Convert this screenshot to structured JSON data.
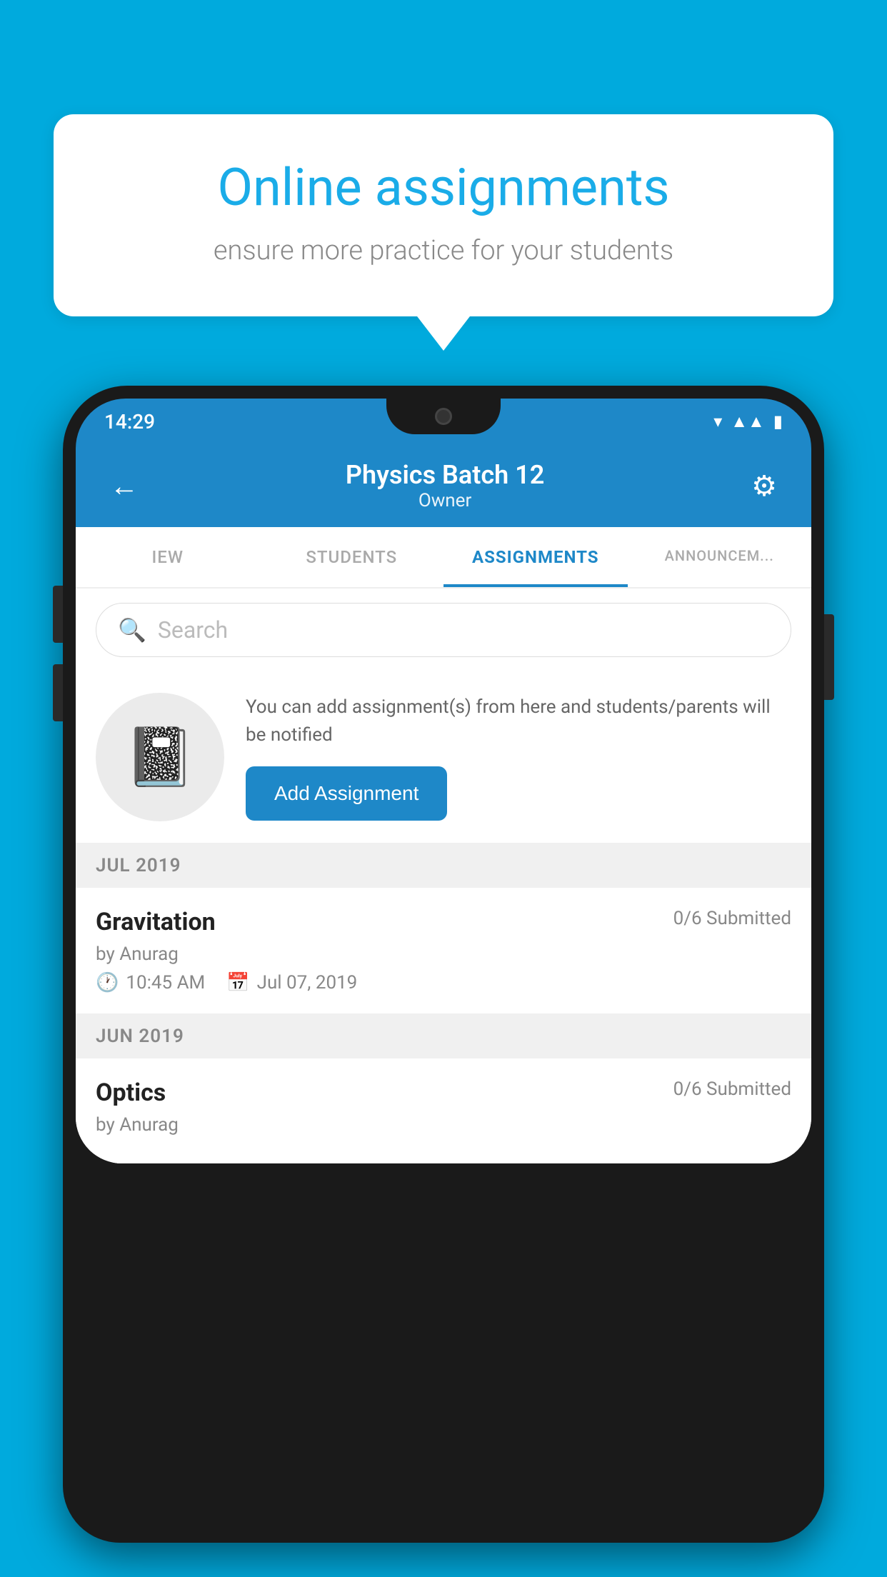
{
  "background_color": "#00AADD",
  "speech_bubble": {
    "title": "Online assignments",
    "subtitle": "ensure more practice for your students"
  },
  "status_bar": {
    "time": "14:29",
    "icons": [
      "wifi",
      "signal",
      "battery"
    ]
  },
  "app_bar": {
    "title": "Physics Batch 12",
    "subtitle": "Owner",
    "back_label": "←",
    "settings_label": "⚙"
  },
  "tabs": [
    {
      "label": "IEW",
      "active": false
    },
    {
      "label": "STUDENTS",
      "active": false
    },
    {
      "label": "ASSIGNMENTS",
      "active": true
    },
    {
      "label": "ANNOUNCEM...",
      "active": false
    }
  ],
  "search": {
    "placeholder": "Search"
  },
  "promo": {
    "description": "You can add assignment(s) from here and students/parents will be notified",
    "button_label": "Add Assignment"
  },
  "months": [
    {
      "label": "JUL 2019",
      "assignments": [
        {
          "title": "Gravitation",
          "submitted": "0/6 Submitted",
          "author": "by Anurag",
          "time": "10:45 AM",
          "date": "Jul 07, 2019"
        }
      ]
    },
    {
      "label": "JUN 2019",
      "assignments": [
        {
          "title": "Optics",
          "submitted": "0/6 Submitted",
          "author": "by Anurag",
          "time": "",
          "date": ""
        }
      ]
    }
  ]
}
